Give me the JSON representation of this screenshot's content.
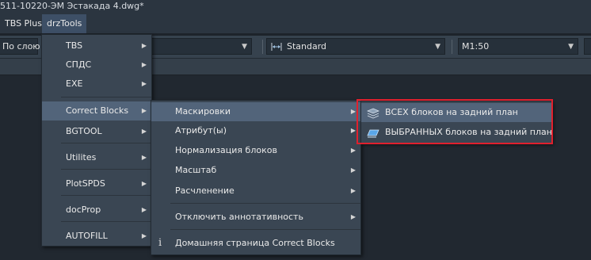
{
  "window": {
    "title": "511-10220-ЭМ  Эстакада 4.dwg*"
  },
  "menubar": [
    {
      "label": "TBS Plus"
    },
    {
      "label": "drzTools"
    }
  ],
  "toolbar": {
    "layer_value": "По слою",
    "textstyle_value": "Standard",
    "scale_value": "M1:50"
  },
  "drz_menu": [
    {
      "label": "TBS"
    },
    {
      "label": "СПДС"
    },
    {
      "label": "EXE"
    },
    {
      "label": "Correct Blocks"
    },
    {
      "label": "BGTOOL"
    },
    {
      "label": "Utilites"
    },
    {
      "label": "PlotSPDS"
    },
    {
      "label": "docProp"
    },
    {
      "label": "AUTOFILL"
    }
  ],
  "correct_blocks_menu": [
    {
      "label": "Маскировки"
    },
    {
      "label": "Атрибут(ы)"
    },
    {
      "label": "Нормализация блоков"
    },
    {
      "label": "Масштаб"
    },
    {
      "label": "Расчленение"
    },
    {
      "label": "Отключить аннотативность"
    },
    {
      "label": "Домашняя страница Correct Blocks",
      "icon": "info-icon"
    }
  ],
  "masking_menu": [
    {
      "label": "ВСЕХ блоков на задний план",
      "icon": "layers-stack-icon"
    },
    {
      "label": "ВЫБРАННЫХ блоков на задний план",
      "icon": "layer-plane-icon"
    }
  ]
}
